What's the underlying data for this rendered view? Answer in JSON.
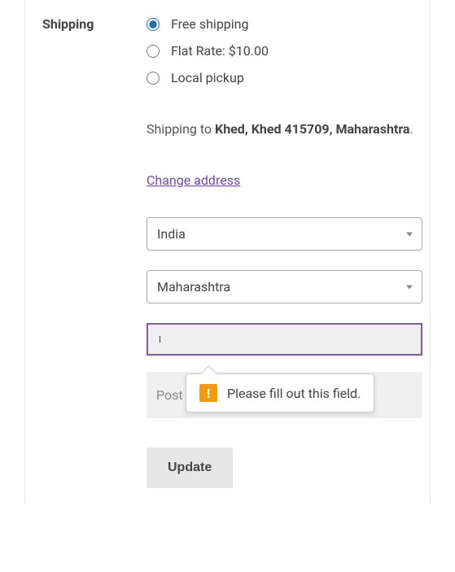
{
  "label": "Shipping",
  "shipping_options": [
    {
      "name": "free-shipping",
      "label": "Free shipping",
      "checked": true
    },
    {
      "name": "flat-rate",
      "label": "Flat Rate: $10.00",
      "checked": false
    },
    {
      "name": "local-pickup",
      "label": "Local pickup",
      "checked": false
    }
  ],
  "shipping_to_prefix": "Shipping to ",
  "shipping_to_address": "Khed, Khed 415709, Maharashtra",
  "shipping_to_suffix": ".",
  "change_address_label": "Change address",
  "country_value": "India",
  "state_value": "Maharashtra",
  "city_value": "",
  "postcode_placeholder": "Post",
  "validation_message": "Please fill out this field.",
  "update_button_label": "Update"
}
